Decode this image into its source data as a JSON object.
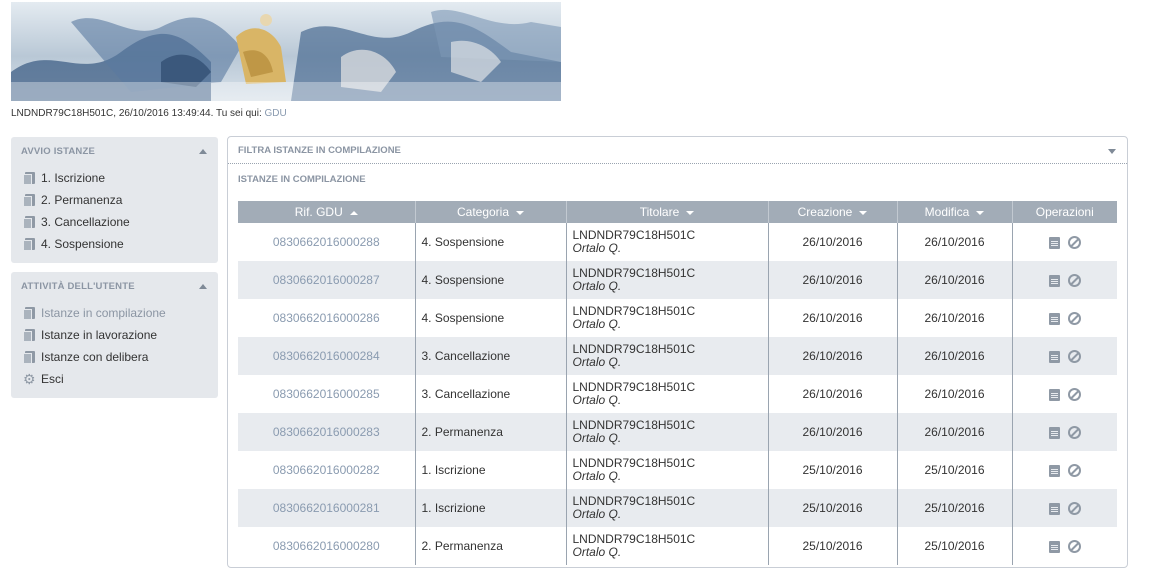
{
  "status": {
    "user": "LNDNDR79C18H501C, 26/10/2016 13:49:44.",
    "you_are_here": "Tu sei qui:",
    "breadcrumb": "GDU"
  },
  "sidebar": {
    "avvio": {
      "title": "AVVIO ISTANZE",
      "items": [
        {
          "label": "1. Iscrizione",
          "icon": "document-icon"
        },
        {
          "label": "2. Permanenza",
          "icon": "document-icon"
        },
        {
          "label": "3. Cancellazione",
          "icon": "document-icon"
        },
        {
          "label": "4. Sospensione",
          "icon": "document-icon"
        }
      ]
    },
    "attivita": {
      "title": "ATTIVITÀ DELL'UTENTE",
      "items": [
        {
          "label": "Istanze in compilazione",
          "icon": "document-icon",
          "active": true
        },
        {
          "label": "Istanze in lavorazione",
          "icon": "document-icon"
        },
        {
          "label": "Istanze con delibera",
          "icon": "document-icon"
        },
        {
          "label": "Esci",
          "icon": "gear-icon"
        }
      ]
    }
  },
  "main": {
    "filter_title": "FILTRA ISTANZE IN COMPILAZIONE",
    "section_title": "ISTANZE IN COMPILAZIONE",
    "columns": [
      "Rif. GDU",
      "Categoria",
      "Titolare",
      "Creazione",
      "Modifica",
      "Operazioni"
    ],
    "rows": [
      {
        "ref": "0830662016000288",
        "category": "4. Sospensione",
        "holder_code": "LNDNDR79C18H501C",
        "holder_name": "Ortalo Q.",
        "created": "26/10/2016",
        "modified": "26/10/2016"
      },
      {
        "ref": "0830662016000287",
        "category": "4. Sospensione",
        "holder_code": "LNDNDR79C18H501C",
        "holder_name": "Ortalo Q.",
        "created": "26/10/2016",
        "modified": "26/10/2016"
      },
      {
        "ref": "0830662016000286",
        "category": "4. Sospensione",
        "holder_code": "LNDNDR79C18H501C",
        "holder_name": "Ortalo Q.",
        "created": "26/10/2016",
        "modified": "26/10/2016"
      },
      {
        "ref": "0830662016000284",
        "category": "3. Cancellazione",
        "holder_code": "LNDNDR79C18H501C",
        "holder_name": "Ortalo Q.",
        "created": "26/10/2016",
        "modified": "26/10/2016"
      },
      {
        "ref": "0830662016000285",
        "category": "3. Cancellazione",
        "holder_code": "LNDNDR79C18H501C",
        "holder_name": "Ortalo Q.",
        "created": "26/10/2016",
        "modified": "26/10/2016"
      },
      {
        "ref": "0830662016000283",
        "category": "2. Permanenza",
        "holder_code": "LNDNDR79C18H501C",
        "holder_name": "Ortalo Q.",
        "created": "26/10/2016",
        "modified": "26/10/2016"
      },
      {
        "ref": "0830662016000282",
        "category": "1. Iscrizione",
        "holder_code": "LNDNDR79C18H501C",
        "holder_name": "Ortalo Q.",
        "created": "25/10/2016",
        "modified": "25/10/2016"
      },
      {
        "ref": "0830662016000281",
        "category": "1. Iscrizione",
        "holder_code": "LNDNDR79C18H501C",
        "holder_name": "Ortalo Q.",
        "created": "25/10/2016",
        "modified": "25/10/2016"
      },
      {
        "ref": "0830662016000280",
        "category": "2. Permanenza",
        "holder_code": "LNDNDR79C18H501C",
        "holder_name": "Ortalo Q.",
        "created": "25/10/2016",
        "modified": "25/10/2016"
      }
    ]
  },
  "colors": {
    "accent": "#8a9bb0",
    "header_bg": "#a2acb7",
    "sidebar_bg": "#e5e8ec",
    "row_alt": "#e8ebef"
  }
}
